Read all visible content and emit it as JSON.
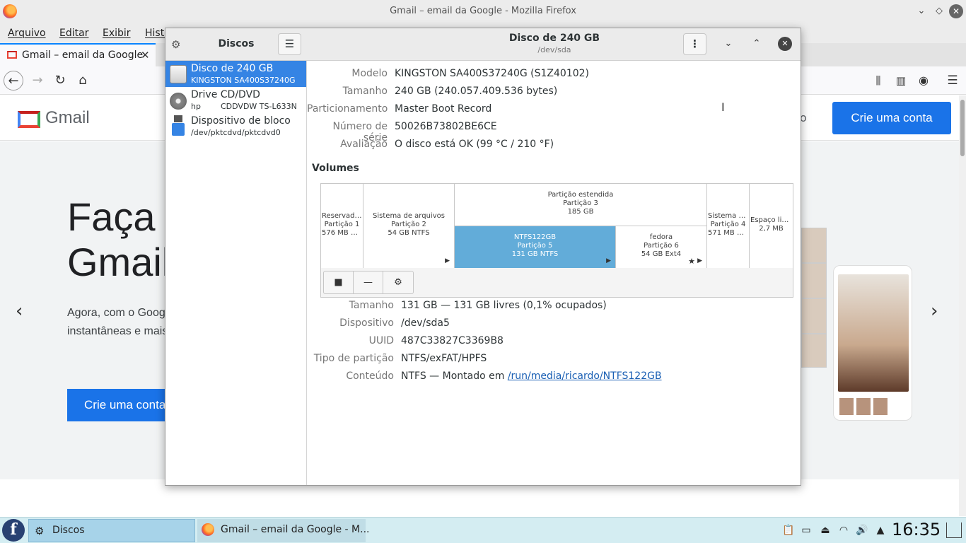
{
  "firefox": {
    "window_title": "Gmail – email da Google - Mozilla Firefox",
    "menus": [
      "Arquivo",
      "Editar",
      "Exibir",
      "Histórico"
    ],
    "tab_title": "Gmail – email da Google",
    "page": {
      "logo_text": "Gmail",
      "create_account": "Crie uma conta",
      "headline": "Faça mais no Gmail",
      "sub_text": "Agora, com o Google Meet, com legendas instantâneas e mais pessoas.",
      "create_account_main": "Crie uma conta",
      "partial_text": "o"
    }
  },
  "disks": {
    "sidebar_title": "Discos",
    "devices": [
      {
        "name": "Disco de 240 GB",
        "sub": "KINGSTON SA400S37240G",
        "sub2": "",
        "icon": "hard-disk-icon",
        "selected": true
      },
      {
        "name": "Drive CD/DVD",
        "sub": "hp",
        "sub2": "CDDVDW TS-L633N",
        "icon": "optical-drive-icon",
        "selected": false
      },
      {
        "name": "Dispositivo de bloco",
        "sub": "/dev/pktcdvd/pktcdvd0",
        "sub2": "",
        "icon": "usb-block-device-icon",
        "selected": false
      }
    ],
    "header_title": "Disco de 240 GB",
    "header_sub": "/dev/sda",
    "disk_props": [
      {
        "label": "Modelo",
        "value": "KINGSTON SA400S37240G (S1Z40102)"
      },
      {
        "label": "Tamanho",
        "value": "240 GB (240.057.409.536 bytes)"
      },
      {
        "label": "Particionamento",
        "value": "Master Boot Record"
      },
      {
        "label": "Número de série",
        "value": "50026B73802BE6CE"
      },
      {
        "label": "Avaliação",
        "value": "O disco está OK (99 °C / 210 °F)"
      }
    ],
    "volumes_title": "Volumes",
    "partitions": {
      "p1": {
        "l1": "Reservado...",
        "l2": "Partição 1",
        "l3": "576 MB NT..."
      },
      "p2": {
        "l1": "Sistema de arquivos",
        "l2": "Partição 2",
        "l3": "54 GB NTFS"
      },
      "p3": {
        "l1": "Partição estendida",
        "l2": "Partição 3",
        "l3": "185 GB"
      },
      "p5": {
        "l1": "NTFS122GB",
        "l2": "Partição 5",
        "l3": "131 GB NTFS"
      },
      "p6": {
        "l1": "fedora",
        "l2": "Partição 6",
        "l3": "54 GB Ext4"
      },
      "p4": {
        "l1": "Sistema d...",
        "l2": "Partição 4",
        "l3": "571 MB NT..."
      },
      "free": {
        "l1": "Espaço livre",
        "l2": "2,7 MB"
      }
    },
    "toolbar_icons": {
      "stop": "■",
      "remove": "—",
      "more": "⚙"
    },
    "volume_props": [
      {
        "label": "Tamanho",
        "value": "131 GB — 131 GB livres (0,1% ocupados)"
      },
      {
        "label": "Dispositivo",
        "value": "/dev/sda5"
      },
      {
        "label": "UUID",
        "value": "487C33827C3369B8"
      },
      {
        "label": "Tipo de partição",
        "value": "NTFS/exFAT/HPFS"
      }
    ],
    "content_label": "Conteúdo",
    "content_prefix": "NTFS — Montado em ",
    "content_link": "/run/media/ricardo/NTFS122GB"
  },
  "taskbar": {
    "start_icon": "f",
    "tasks": [
      {
        "label": "Discos"
      },
      {
        "label": "Gmail – email da Google - M..."
      }
    ],
    "clock": "16:35"
  }
}
